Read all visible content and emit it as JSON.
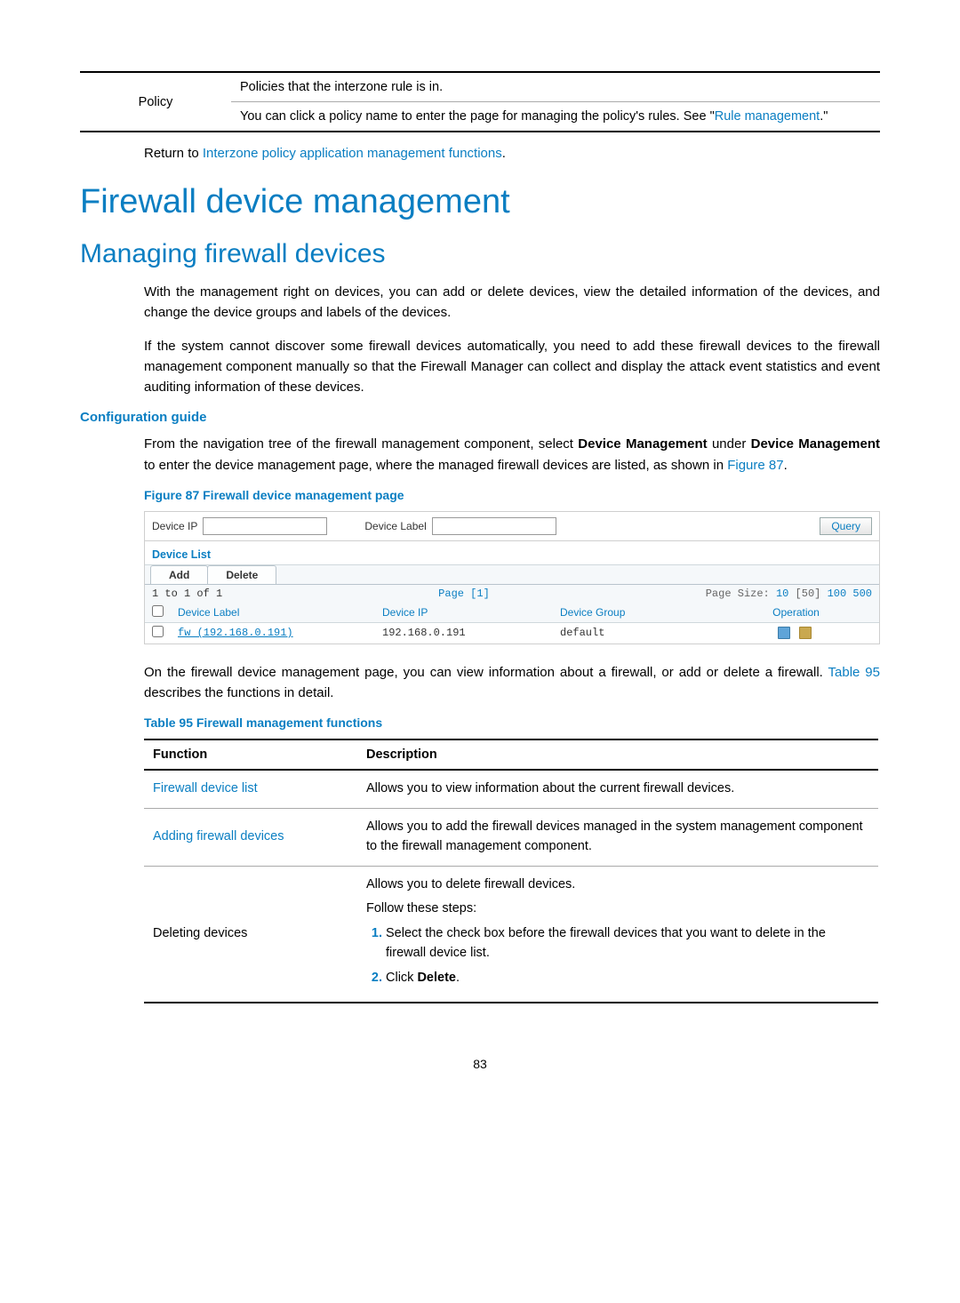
{
  "page_number": "83",
  "top_table": {
    "col1": "Policy",
    "line1": "Policies that the interzone rule is in.",
    "line2_a": "You can click a policy name to enter the page for managing the policy's rules. See \"",
    "line2_link": "Rule management",
    "line2_b": ".\""
  },
  "return_line": {
    "prefix": "Return to ",
    "link": "Interzone policy application management functions",
    "suffix": "."
  },
  "h1": "Firewall device management",
  "h2": "Managing firewall devices",
  "para1": "With the management right on devices, you can add or delete devices, view the detailed information of the devices, and change the device groups and labels of the devices.",
  "para2": "If the system cannot discover some firewall devices automatically, you need to add these firewall devices to the firewall management component manually so that the Firewall Manager can collect and display the attack event statistics and event auditing information of these devices.",
  "h4_config": "Configuration guide",
  "para3": {
    "a": "From the navigation tree of the firewall management component, select ",
    "b": "Device Management",
    "c": " under ",
    "d": "Device Management",
    "e": " to enter the device management page, where the managed firewall devices are listed, as shown in ",
    "f": "Figure 87",
    "g": "."
  },
  "fig_caption": "Figure 87 Firewall device management page",
  "screenshot": {
    "device_ip_label": "Device IP",
    "device_label_label": "Device Label",
    "query_btn": "Query",
    "device_list_header": "Device List",
    "add_btn": "Add",
    "delete_btn": "Delete",
    "range": "1 to 1 of 1",
    "page_label": "Page [1]",
    "page_size_prefix": "Page Size: ",
    "page_size_10": "10",
    "page_size_50": " [50] ",
    "page_size_100": "100",
    "page_size_500": " 500",
    "cols": {
      "device_label": "Device Label",
      "device_ip": "Device IP",
      "device_group": "Device Group",
      "operation": "Operation"
    },
    "row": {
      "label": "fw (192.168.0.191)",
      "ip": "192.168.0.191",
      "group": "default"
    }
  },
  "para4": {
    "a": "On the firewall device management page, you can view information about a firewall, or add or delete a firewall. ",
    "link": "Table 95",
    "b": " describes the functions in detail."
  },
  "table95_caption": "Table 95 Firewall management functions",
  "table95": {
    "h_function": "Function",
    "h_description": "Description",
    "r1_f": "Firewall device list",
    "r1_d": "Allows you to view information about the current firewall devices.",
    "r2_f": "Adding firewall devices",
    "r2_d": "Allows you to add the firewall devices managed in the system management component to the firewall management component.",
    "r3_f": "Deleting devices",
    "r3_d1": "Allows you to delete firewall devices.",
    "r3_d2": "Follow these steps:",
    "r3_step1": "Select the check box before the firewall devices that you want to delete in the firewall device list.",
    "r3_step2a": "Click ",
    "r3_step2b": "Delete",
    "r3_step2c": "."
  }
}
